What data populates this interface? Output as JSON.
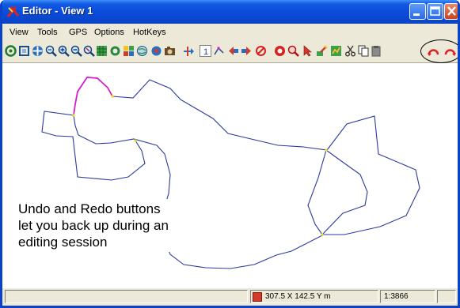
{
  "window": {
    "title": "Editor - View 1",
    "app_icon": "editor-tool-icon"
  },
  "menu": {
    "items": [
      "View",
      "Tools",
      "GPS",
      "Options",
      "HotKeys"
    ]
  },
  "toolbar": {
    "icons": [
      "redraw-icon",
      "select-rectangle-icon",
      "pan-icon",
      "zoom-to-full-icon",
      "zoom-in-icon",
      "zoom-out-icon",
      "zoom-previous-icon",
      "zoom-extents-icon",
      "zoom-to-layer-icon",
      "zoom-to-selection-icon",
      "layer-manager-icon",
      "gps-icon",
      "camera-icon",
      "add-element-icon",
      "snap-toggle-icon",
      "edit-vertex-icon",
      "move-left-icon",
      "move-right-icon",
      "delete-icon",
      "query-icon",
      "find-icon",
      "pointer-icon",
      "paint-icon",
      "properties-icon",
      "cut-icon",
      "copy-icon",
      "paste-icon",
      "undo-icon",
      "redo-icon"
    ],
    "snap_label": "1",
    "undo_label": "Undo",
    "redo_label": "Redo"
  },
  "callout": {
    "text": "Undo and Redo buttons let you back up during an editing session"
  },
  "status": {
    "coordinates": "307.5 X  142.5 Y m",
    "scale": "1:3866"
  },
  "colors": {
    "title_bar": "#0a4ad8",
    "line": "#2a3a9c",
    "selected_line": "#d21fcc",
    "node": "#e8e018",
    "undo_redo_icon": "#e02020"
  }
}
